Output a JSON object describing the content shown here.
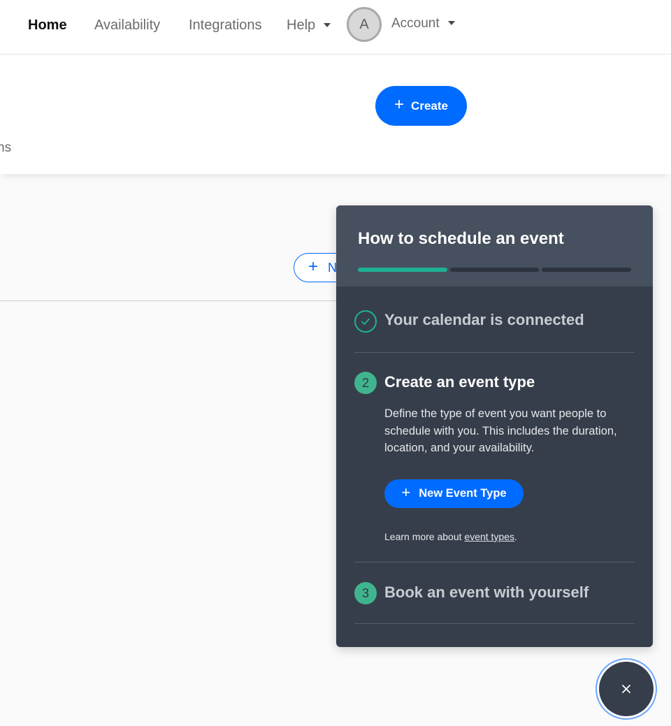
{
  "nav": {
    "home": "Home",
    "availability": "Availability",
    "integrations": "Integrations",
    "help": "Help",
    "avatar_initial": "A",
    "account": "Account"
  },
  "header": {
    "create_label": "Create",
    "clipped_text": "ns"
  },
  "body": {
    "new_button_clipped": "N"
  },
  "onboarding": {
    "title": "How to schedule an event",
    "progress": {
      "completed_steps": 1,
      "total_steps": 3
    },
    "steps": [
      {
        "number": "",
        "title": "Your calendar is connected",
        "status": "completed"
      },
      {
        "number": "2",
        "title": "Create an event type",
        "status": "active",
        "description": "Define the type of event you want people to schedule with you. This includes the duration, location, and your availability.",
        "button_label": "New Event Type",
        "learn_more_prefix": "Learn more about ",
        "learn_more_link": "event types",
        "learn_more_suffix": "."
      },
      {
        "number": "3",
        "title": "Book an event with yourself",
        "status": "pending"
      }
    ]
  },
  "fab": {
    "icon": "close-icon"
  },
  "colors": {
    "primary": "#006bff",
    "teal": "#1fb193",
    "panel_bg": "#363e4b",
    "panel_header_bg": "#47505e"
  }
}
